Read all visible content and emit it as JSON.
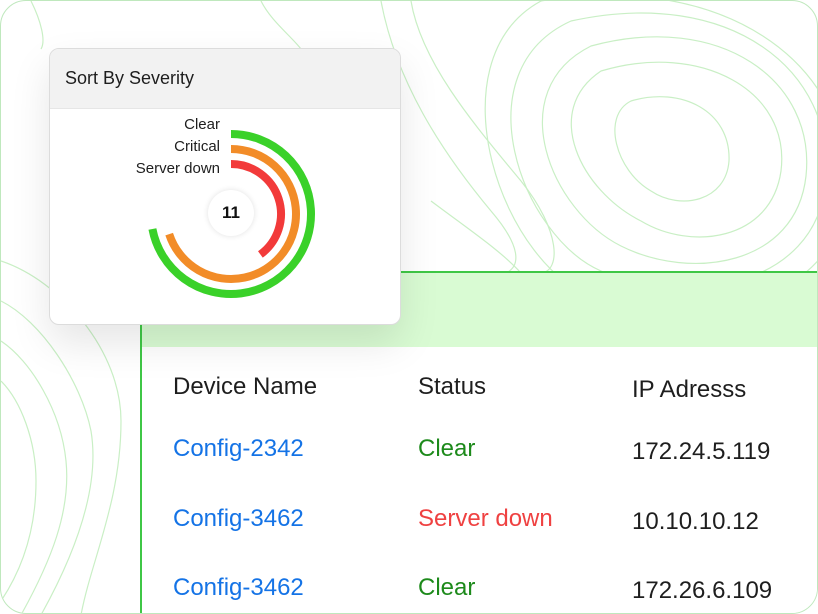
{
  "severity_card": {
    "title": "Sort By Severity",
    "total": "11",
    "segments": [
      {
        "label": "Clear",
        "color": "#3ad129",
        "fraction": 0.72
      },
      {
        "label": "Critical",
        "color": "#f28c28",
        "fraction": 0.7
      },
      {
        "label": "Server down",
        "color": "#f23a3a",
        "fraction": 0.4
      }
    ]
  },
  "device_table": {
    "columns": [
      "Device Name",
      "Status",
      "IP Adresss"
    ],
    "rows": [
      {
        "device": "Config-2342",
        "status": "Clear",
        "ip": "172.24.5.119"
      },
      {
        "device": "Config-3462",
        "status": "Server down",
        "ip": "10.10.10.12"
      },
      {
        "device": "Config-3462",
        "status": "Clear",
        "ip": "172.26.6.109"
      }
    ]
  },
  "colors": {
    "link": "#1473e6",
    "status_clear": "#1d8a1b",
    "status_server_down": "#ef4141",
    "accent_green": "#3fc746",
    "header_band": "#d9fbd3"
  }
}
